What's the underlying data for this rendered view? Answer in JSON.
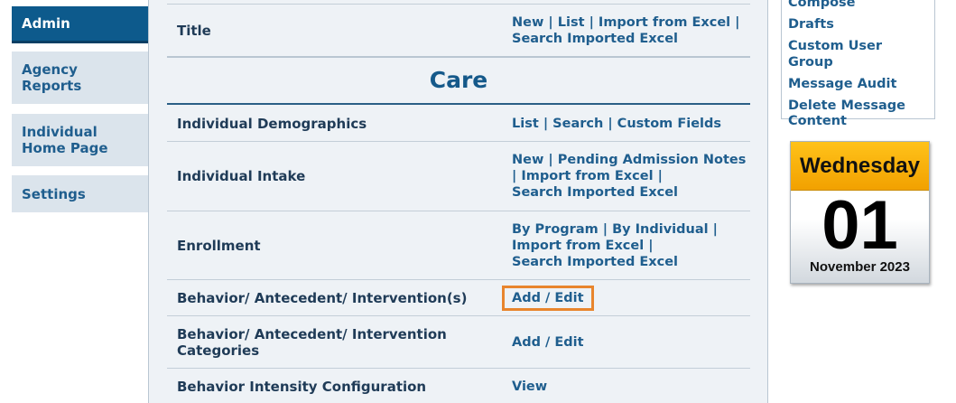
{
  "nav": {
    "items": [
      {
        "label": "Admin",
        "active": true
      },
      {
        "label": "Agency Reports",
        "active": false
      },
      {
        "label": "Individual Home Page",
        "active": false
      },
      {
        "label": "Settings",
        "active": false
      }
    ]
  },
  "main": {
    "section_title": "Care",
    "rows": [
      {
        "name": "Title",
        "actions": [
          "New | List | Import from Excel |",
          "Search Imported Excel"
        ]
      },
      {
        "name": "Individual Demographics",
        "actions": [
          "List | Search | Custom Fields"
        ]
      },
      {
        "name": "Individual Intake",
        "actions": [
          "New | Pending Admission Notes",
          "| Import from Excel |",
          "Search Imported Excel"
        ]
      },
      {
        "name": "Enrollment",
        "actions": [
          "By Program | By Individual |",
          "Import from Excel |",
          "Search Imported Excel"
        ]
      },
      {
        "name": "Behavior/ Antecedent/ Intervention(s)",
        "actions": [
          "Add / Edit"
        ],
        "highlighted": true
      },
      {
        "name": "Behavior/ Antecedent/ Intervention Categories",
        "actions": [
          "Add / Edit"
        ]
      },
      {
        "name": "Behavior Intensity Configuration",
        "actions": [
          "View"
        ]
      }
    ]
  },
  "messages": {
    "links": [
      "Compose",
      "Drafts",
      "Custom User Group",
      "Message Audit",
      "Delete Message Content"
    ]
  },
  "calendar": {
    "weekday": "Wednesday",
    "day": "01",
    "month_year": "November 2023",
    "header_color": "#ffb400"
  },
  "colors": {
    "nav_active": "#0d5a8c",
    "nav_inactive": "#dbe4ec",
    "link": "#1f5e8e",
    "highlight": "#e8852d"
  }
}
